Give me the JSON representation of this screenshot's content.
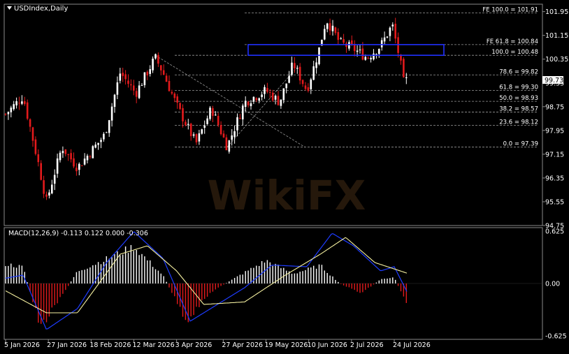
{
  "title": "USDIndex,Daily",
  "price_label": "99.73",
  "colors": {
    "background": "#000000",
    "up_candle": "#FFFFFF",
    "down_candle": "#E31A1C",
    "macd_line": "#1E3CFF",
    "signal_line": "#F5F0A0",
    "zone": "#2030FF",
    "grid": "#9A9A9A",
    "text": "#FFFFFF"
  },
  "y_axis": {
    "ticks": [
      "101.95",
      "101.15",
      "100.35",
      "99.55",
      "98.75",
      "97.95",
      "97.15",
      "96.35",
      "95.55",
      "94.75"
    ]
  },
  "x_axis": {
    "labels": [
      "5 Jan 2026",
      "27 Jan 2026",
      "18 Feb 2026",
      "12 Mar 2026",
      "3 Apr 2026",
      "27 Apr 2026",
      "19 May 2026",
      "10 Jun 2026",
      "2 Jul 2026",
      "24 Jul 2026"
    ]
  },
  "fib_levels": [
    {
      "label": "FE 100.0 = 101.91",
      "value": 101.91
    },
    {
      "label": "FE 61.8 = 100.84",
      "value": 100.84
    },
    {
      "label": "100.0 = 100.48",
      "value": 100.48
    },
    {
      "label": "78.6 = 99.82",
      "value": 99.82
    },
    {
      "label": "61.8 = 99.30",
      "value": 99.3
    },
    {
      "label": "50.0 = 98.93",
      "value": 98.93
    },
    {
      "label": "38.2 = 98.57",
      "value": 98.57
    },
    {
      "label": "23.6 = 98.12",
      "value": 98.12
    },
    {
      "label": "0.0 = 97.39",
      "value": 97.39
    }
  ],
  "macd": {
    "label": "MACD(12,26,9) -0.113 0.122 0.000 -0.306",
    "ticks": [
      "0.625",
      "0.00",
      "-0.625"
    ]
  },
  "chart_data": {
    "type": "candlestick",
    "symbol": "USDIndex",
    "timeframe": "Daily",
    "ylim": [
      94.75,
      102.2
    ],
    "current_price": 99.73,
    "resistance_zone": [
      100.48,
      100.84
    ],
    "anchor_points": [
      {
        "x": "2 Jan 2026",
        "y": 98.3
      },
      {
        "x": "14 Jan 2026",
        "y": 99.1
      },
      {
        "x": "22 Jan 2026",
        "y": 96.8
      },
      {
        "x": "26 Jan 2026",
        "y": 95.55
      },
      {
        "x": "3 Feb 2026",
        "y": 97.4
      },
      {
        "x": "11 Feb 2026",
        "y": 96.7
      },
      {
        "x": "25 Feb 2026",
        "y": 97.8
      },
      {
        "x": "5 Mar 2026",
        "y": 99.9
      },
      {
        "x": "13 Mar 2026",
        "y": 99.2
      },
      {
        "x": "23 Mar 2026",
        "y": 100.4
      },
      {
        "x": "27 Mar 2026",
        "y": 99.9
      },
      {
        "x": "3 Apr 2026",
        "y": 98.8
      },
      {
        "x": "13 Apr 2026",
        "y": 97.5
      },
      {
        "x": "21 Apr 2026",
        "y": 98.7
      },
      {
        "x": "29 Apr 2026",
        "y": 97.4
      },
      {
        "x": "8 May 2026",
        "y": 98.9
      },
      {
        "x": "19 May 2026",
        "y": 99.3
      },
      {
        "x": "26 May 2026",
        "y": 98.9
      },
      {
        "x": "2 Jun 2026",
        "y": 100.2
      },
      {
        "x": "9 Jun 2026",
        "y": 99.3
      },
      {
        "x": "15 Jun 2026",
        "y": 100.6
      },
      {
        "x": "19 Jun 2026",
        "y": 101.7
      },
      {
        "x": "26 Jun 2026",
        "y": 100.9
      },
      {
        "x": "3 Jul 2026",
        "y": 100.7
      },
      {
        "x": "10 Jul 2026",
        "y": 100.4
      },
      {
        "x": "17 Jul 2026",
        "y": 100.8
      },
      {
        "x": "23 Jul 2026",
        "y": 101.5
      },
      {
        "x": "27 Jul 2026",
        "y": 100.3
      },
      {
        "x": "29 Jul 2026",
        "y": 99.5
      },
      {
        "x": "31 Jul 2026",
        "y": 99.73
      }
    ],
    "macd_histogram_envelope": [
      {
        "x": "2 Jan 2026",
        "y": 0.25
      },
      {
        "x": "14 Jan 2026",
        "y": 0.2
      },
      {
        "x": "23 Jan 2026",
        "y": -0.55
      },
      {
        "x": "3 Feb 2026",
        "y": -0.15
      },
      {
        "x": "11 Feb 2026",
        "y": 0.15
      },
      {
        "x": "26 Feb 2026",
        "y": 0.3
      },
      {
        "x": "12 Mar 2026",
        "y": 0.45
      },
      {
        "x": "27 Mar 2026",
        "y": 0.1
      },
      {
        "x": "8 Apr 2026",
        "y": -0.45
      },
      {
        "x": "21 Apr 2026",
        "y": -0.1
      },
      {
        "x": "4 May 2026",
        "y": 0.08
      },
      {
        "x": "19 May 2026",
        "y": 0.28
      },
      {
        "x": "2 Jun 2026",
        "y": 0.12
      },
      {
        "x": "16 Jun 2026",
        "y": 0.22
      },
      {
        "x": "26 Jun 2026",
        "y": 0.0
      },
      {
        "x": "7 Jul 2026",
        "y": -0.12
      },
      {
        "x": "17 Jul 2026",
        "y": 0.05
      },
      {
        "x": "24 Jul 2026",
        "y": 0.08
      },
      {
        "x": "31 Jul 2026",
        "y": -0.3
      }
    ],
    "macd_main_line": [
      {
        "x": "2 Jan 2026",
        "y": 0.05
      },
      {
        "x": "14 Jan 2026",
        "y": 0.1
      },
      {
        "x": "26 Jan 2026",
        "y": -0.55
      },
      {
        "x": "11 Feb 2026",
        "y": -0.3
      },
      {
        "x": "26 Feb 2026",
        "y": 0.25
      },
      {
        "x": "12 Mar 2026",
        "y": 0.62
      },
      {
        "x": "27 Mar 2026",
        "y": 0.3
      },
      {
        "x": "10 Apr 2026",
        "y": -0.45
      },
      {
        "x": "24 Apr 2026",
        "y": -0.25
      },
      {
        "x": "8 May 2026",
        "y": -0.05
      },
      {
        "x": "22 May 2026",
        "y": 0.22
      },
      {
        "x": "9 Jun 2026",
        "y": 0.2
      },
      {
        "x": "22 Jun 2026",
        "y": 0.6
      },
      {
        "x": "3 Jul 2026",
        "y": 0.45
      },
      {
        "x": "17 Jul 2026",
        "y": 0.15
      },
      {
        "x": "24 Jul 2026",
        "y": 0.2
      },
      {
        "x": "31 Jul 2026",
        "y": -0.12
      }
    ],
    "macd_signal_line": [
      {
        "x": "2 Jan 2026",
        "y": -0.05
      },
      {
        "x": "26 Jan 2026",
        "y": -0.35
      },
      {
        "x": "11 Feb 2026",
        "y": -0.35
      },
      {
        "x": "5 Mar 2026",
        "y": 0.35
      },
      {
        "x": "19 Mar 2026",
        "y": 0.45
      },
      {
        "x": "3 Apr 2026",
        "y": 0.15
      },
      {
        "x": "17 Apr 2026",
        "y": -0.25
      },
      {
        "x": "8 May 2026",
        "y": -0.22
      },
      {
        "x": "29 May 2026",
        "y": 0.1
      },
      {
        "x": "16 Jun 2026",
        "y": 0.35
      },
      {
        "x": "29 Jun 2026",
        "y": 0.55
      },
      {
        "x": "14 Jul 2026",
        "y": 0.25
      },
      {
        "x": "31 Jul 2026",
        "y": 0.12
      }
    ]
  }
}
